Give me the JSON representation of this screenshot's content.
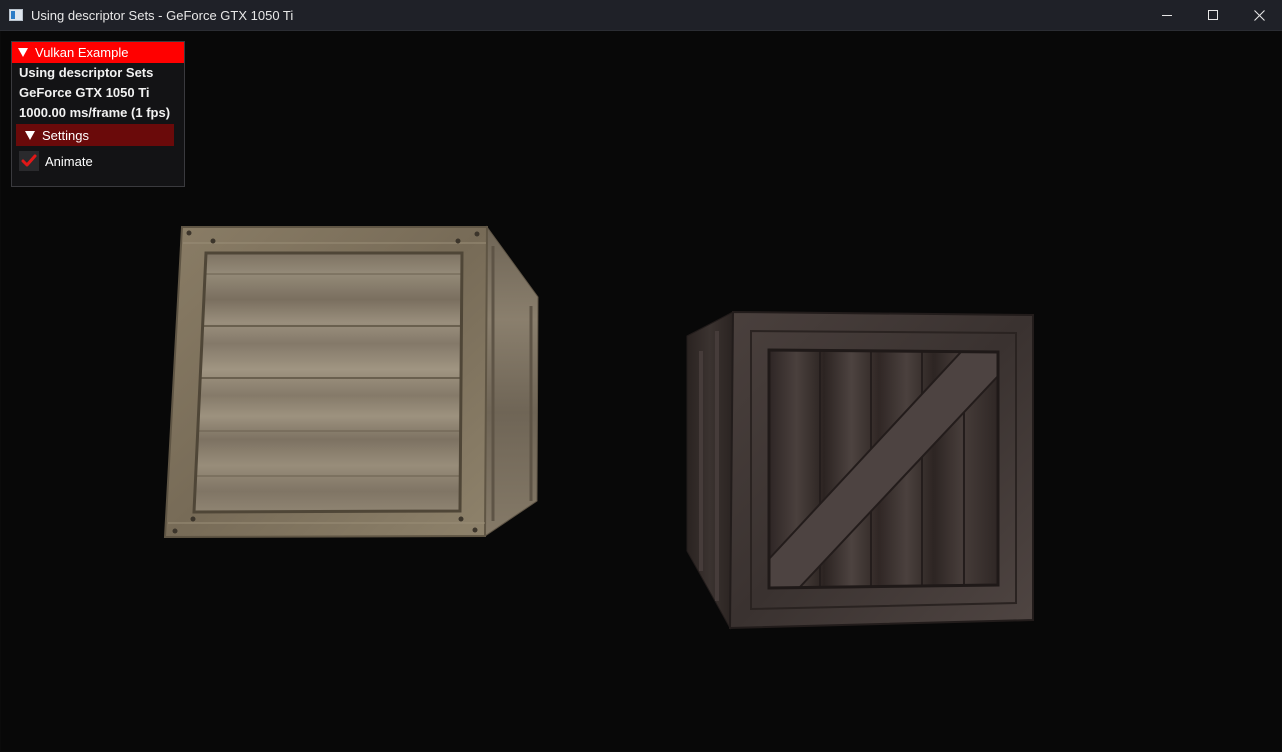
{
  "window": {
    "title": "Using descriptor Sets - GeForce GTX 1050 Ti",
    "controls": [
      "minimize-icon",
      "maximize-icon",
      "close-icon"
    ]
  },
  "overlay": {
    "header": "Vulkan Example",
    "lines": [
      "Using descriptor Sets",
      "GeForce GTX 1050 Ti",
      "1000.00 ms/frame (1 fps)"
    ],
    "settings_header": "Settings",
    "animate_label": "Animate",
    "animate_checked": true
  },
  "scene": {
    "background": "#080808",
    "cubes": [
      {
        "name": "light-wood-crate",
        "color": "#8c7f6b"
      },
      {
        "name": "dark-wood-crate",
        "color": "#3e3634"
      }
    ]
  },
  "colors": {
    "header_red": "#ff0000",
    "settings_dark_red": "#6a0a0a",
    "check_red": "#e01818"
  }
}
